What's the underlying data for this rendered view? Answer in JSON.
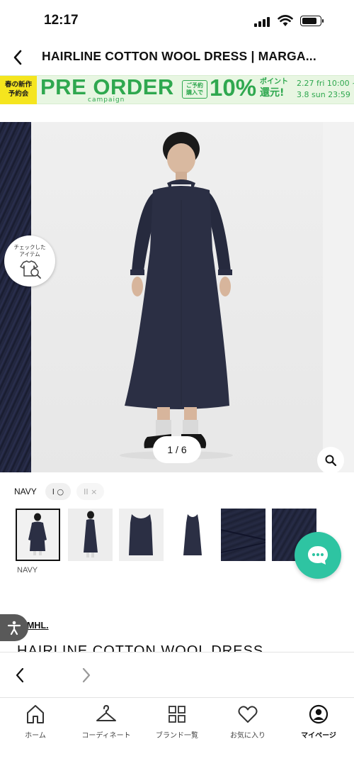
{
  "status_bar": {
    "time": "12:17"
  },
  "header": {
    "title": "HAIRLINE COTTON WOOL DRESS | MARGA..."
  },
  "banner": {
    "tag_line1": "春の新作",
    "tag_line2": "予約会",
    "title": "PRE ORDER",
    "subtitle": "campaign",
    "box_line1": "ご予約",
    "box_line2": "購入で",
    "percent": "10%",
    "point_line1": "ポイント",
    "point_line2": "還元!",
    "date_start": "2.27 fri 10:00 ~",
    "date_end": "3.8 sun 23:59"
  },
  "gallery": {
    "check_item_label": "チェックした\nアイテム",
    "pager": "1 / 6"
  },
  "color": {
    "name": "NAVY",
    "size_available": "I ○",
    "size_unavailable": "II ×"
  },
  "thumbnails": {
    "caption": "NAVY"
  },
  "product": {
    "brand": "MHL.",
    "name": "HAIRLINE COTTON WOOL DRESS"
  },
  "tab_bar": {
    "items": [
      {
        "label": "ホーム",
        "icon": "home-icon"
      },
      {
        "label": "コーディネート",
        "icon": "hanger-icon"
      },
      {
        "label": "ブランド一覧",
        "icon": "grid-icon"
      },
      {
        "label": "お気に入り",
        "icon": "heart-icon"
      },
      {
        "label": "マイページ",
        "icon": "user-icon"
      }
    ]
  },
  "colors": {
    "brand_green": "#2fa84f",
    "chat_green": "#2ec4a2",
    "banner_yellow": "#f5e51e",
    "navy": "#242840"
  }
}
